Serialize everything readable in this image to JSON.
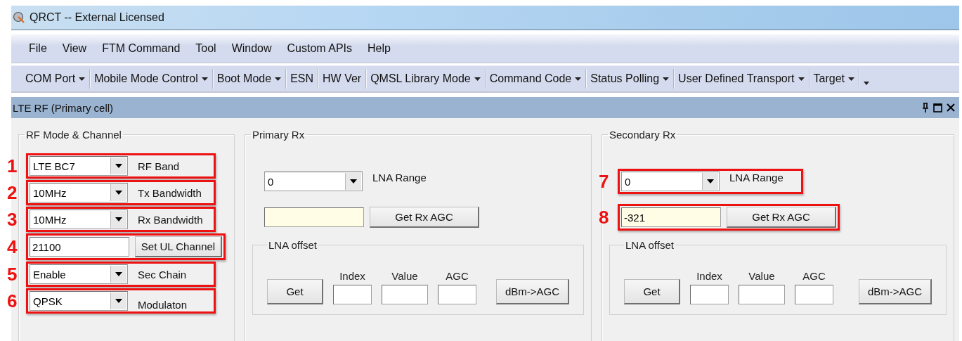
{
  "window": {
    "title": "QRCT -- External Licensed"
  },
  "menu": [
    {
      "label": "File"
    },
    {
      "label": "View"
    },
    {
      "label": "FTM Command"
    },
    {
      "label": "Tool"
    },
    {
      "label": "Window"
    },
    {
      "label": "Custom APIs"
    },
    {
      "label": "Help"
    }
  ],
  "toolbar": [
    {
      "label": "COM Port",
      "dropdown": true
    },
    {
      "label": "Mobile Mode Control",
      "dropdown": true
    },
    {
      "label": "Boot Mode",
      "dropdown": true
    },
    {
      "label": "ESN",
      "dropdown": false
    },
    {
      "label": "HW Ver",
      "dropdown": false
    },
    {
      "label": "QMSL Library Mode",
      "dropdown": true
    },
    {
      "label": "Command Code",
      "dropdown": true
    },
    {
      "label": "Status Polling",
      "dropdown": true
    },
    {
      "label": "User Defined Transport",
      "dropdown": true
    },
    {
      "label": "Target",
      "dropdown": true
    }
  ],
  "panel": {
    "title": "LTE RF (Primary cell)"
  },
  "rf_mode": {
    "title": "RF Mode & Channel",
    "rows": [
      {
        "kind": "dropdown",
        "value": "LTE BC7",
        "label": "RF Band",
        "marker": "1"
      },
      {
        "kind": "dropdown",
        "value": "10MHz",
        "label": "Tx Bandwidth",
        "marker": "2"
      },
      {
        "kind": "dropdown",
        "value": "10MHz",
        "label": "Rx Bandwidth",
        "marker": "3"
      },
      {
        "kind": "entry",
        "value": "21100",
        "button": "Set UL Channel",
        "marker": "4"
      },
      {
        "kind": "dropdown",
        "value": "Enable",
        "label": "Sec Chain",
        "marker": "5"
      },
      {
        "kind": "dropdown",
        "value": "QPSK",
        "label": "Modulaton",
        "marker": "6"
      }
    ]
  },
  "rx_groups": [
    {
      "title": "Primary Rx",
      "lna_range": {
        "value": "0",
        "label": "LNA Range"
      },
      "agc": {
        "button": "Get Rx AGC"
      },
      "lna_offset": {
        "title": "LNA offset",
        "get_button": "Get",
        "fields": [
          {
            "label": "Index"
          },
          {
            "label": "Value"
          },
          {
            "label": "AGC"
          }
        ],
        "convert_button": "dBm->AGC"
      }
    },
    {
      "title": "Secondary Rx",
      "lna_range": {
        "value": "0",
        "label": "LNA Range",
        "marker": "7"
      },
      "agc": {
        "value": "-321",
        "button": "Get Rx AGC",
        "marker": "8"
      },
      "lna_offset": {
        "title": "LNA offset",
        "get_button": "Get",
        "fields": [
          {
            "label": "Index"
          },
          {
            "label": "Value"
          },
          {
            "label": "AGC"
          }
        ],
        "convert_button": "dBm->AGC"
      }
    }
  ]
}
